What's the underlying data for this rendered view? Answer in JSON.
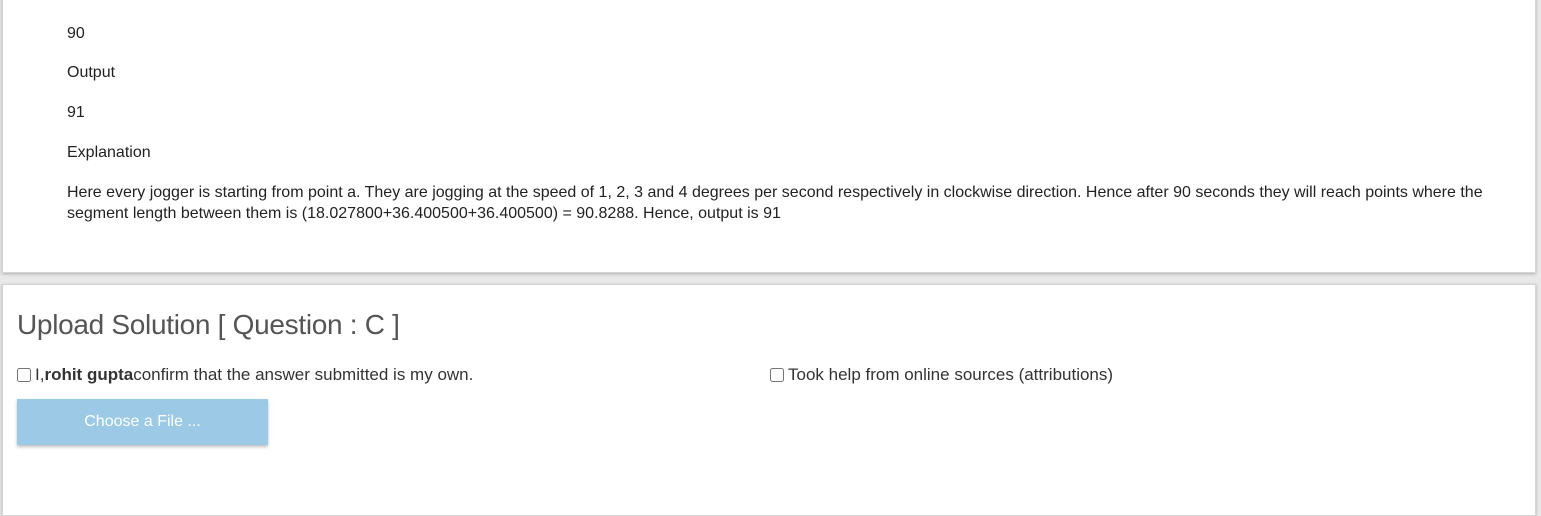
{
  "problem": {
    "input_value": "90",
    "output_heading": "Output",
    "output_value": "91",
    "explanation_heading": "Explanation",
    "explanation_text": "Here every jogger is starting from point a. They are jogging at the speed of 1, 2, 3 and 4 degrees per second respectively in clockwise direction. Hence after 90 seconds they will reach points where the segment length between them is (18.027800+36.400500+36.400500) = 90.8288. Hence, output is 91"
  },
  "upload": {
    "title": "Upload Solution [ Question : C ]",
    "confirm_prefix": "I, ",
    "user_name": "rohit gupta",
    "confirm_suffix": " confirm that the answer submitted is my own.",
    "help_label": "Took help from online sources (attributions)",
    "choose_file_label": "Choose a File ..."
  },
  "colors": {
    "button_bg": "#9cc9e6",
    "panel_bg": "#ffffff",
    "page_bg": "#e9e9e9"
  }
}
